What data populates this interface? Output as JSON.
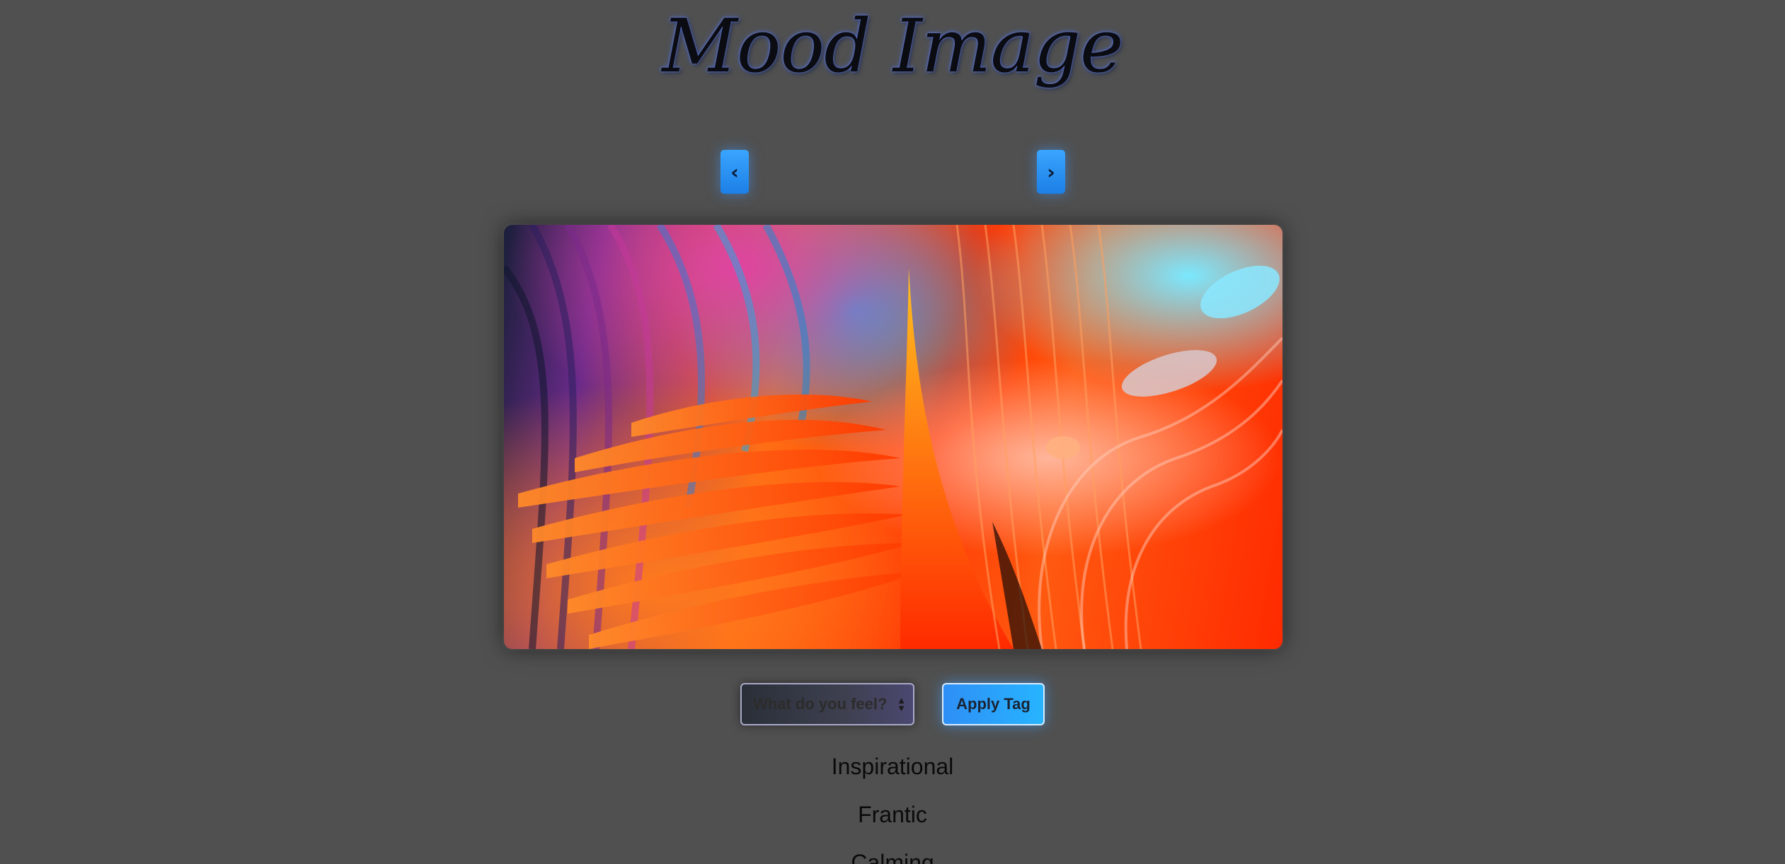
{
  "header": {
    "title": "Mood Image"
  },
  "navigation": {
    "prev_label": "‹",
    "next_label": "›"
  },
  "image": {
    "alt": "abstract colorful wave art"
  },
  "controls": {
    "select_placeholder": "What do you feel?",
    "apply_label": "Apply Tag"
  },
  "tags": [
    "Inspirational",
    "Frantic",
    "Calming"
  ],
  "colors": {
    "background": "#505050",
    "accent": "#2e8ff5"
  }
}
